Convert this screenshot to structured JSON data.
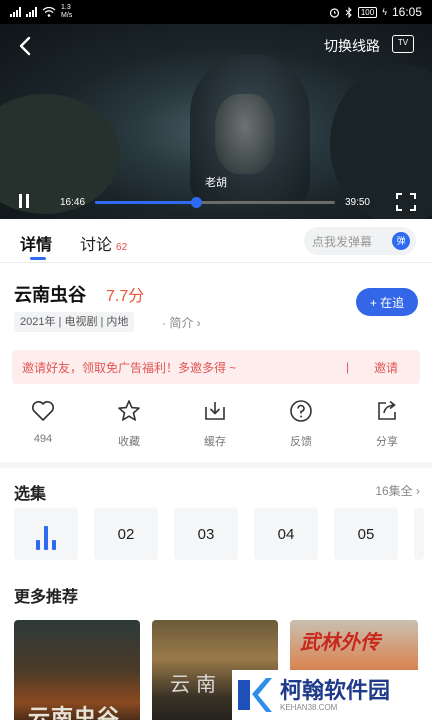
{
  "status_bar": {
    "network_speed": "1.3\nM/s",
    "battery": "100",
    "time": "16:05"
  },
  "player": {
    "switch_line": "切换线路",
    "tv_label": "TV",
    "subtitle": "老胡",
    "current_time": "16:46",
    "total_time": "39:50",
    "progress": 0.42
  },
  "tabs": [
    {
      "label": "详情",
      "active": true
    },
    {
      "label": "讨论",
      "count": "62"
    }
  ],
  "danmaku": {
    "placeholder": "点我发弹幕",
    "icon_label": "弹"
  },
  "show": {
    "title": "云南虫谷",
    "rating": "7.7分",
    "meta": "2021年 | 电视剧 | 内地",
    "intro_link": "· 简介 ›",
    "follow_label": "+ 在追"
  },
  "invite": {
    "text": "邀请好友，领取免广告福利！多邀多得 ~",
    "separator": "|",
    "button": "邀请"
  },
  "actions": [
    {
      "icon": "heart-icon",
      "label": "494"
    },
    {
      "icon": "star-icon",
      "label": "收藏"
    },
    {
      "icon": "download-icon",
      "label": "缓存"
    },
    {
      "icon": "question-icon",
      "label": "反馈"
    },
    {
      "icon": "share-icon",
      "label": "分享"
    }
  ],
  "episodes": {
    "title": "选集",
    "all_label": "16集全  ›",
    "items": [
      "02",
      "03",
      "04",
      "05"
    ]
  },
  "recommend": {
    "title": "更多推荐",
    "poster_texts": [
      "云南虫谷",
      "云南",
      "武林外传"
    ]
  },
  "watermark": {
    "name": "柯翰软件园",
    "url": "KEHAN38.COM"
  },
  "colors": {
    "accent": "#2f6bf0",
    "rating": "#e8563a",
    "invite_bg": "#fdeeed",
    "invite_text": "#e25555"
  }
}
